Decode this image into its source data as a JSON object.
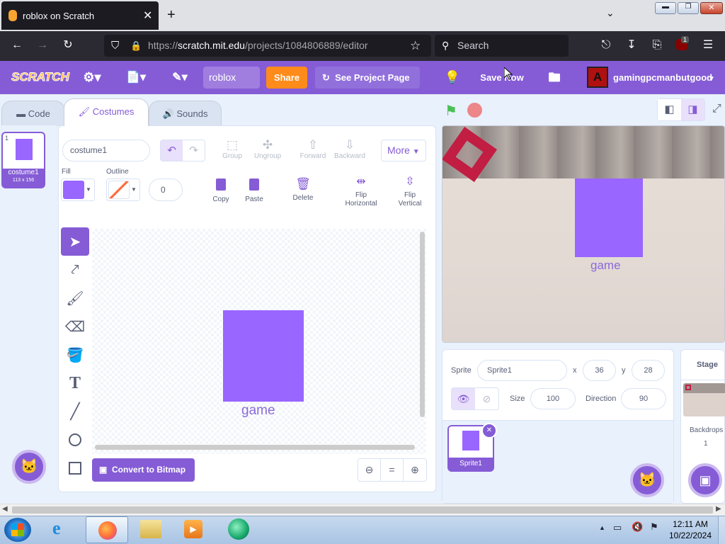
{
  "browser": {
    "tab_title": "roblox on Scratch",
    "url": "https://scratch.mit.edu/projects/1084806889/editor",
    "url_host": "scratch.mit.edu",
    "url_prefix": "https://",
    "url_path": "/projects/1084806889/editor",
    "search_placeholder": "Search",
    "extension_badge": "1"
  },
  "menu": {
    "project_title": "roblox",
    "share_label": "Share",
    "see_project_label": "See Project Page",
    "save_label": "Save Now",
    "username": "gamingpcmanbutgood",
    "brand_color": "#855cd6"
  },
  "tabs": {
    "code": "Code",
    "costumes": "Costumes",
    "sounds": "Sounds"
  },
  "costume_list": [
    {
      "index": "1",
      "name": "costume1",
      "size": "113 x 156"
    }
  ],
  "paint": {
    "costume_name": "costume1",
    "fill_label": "Fill",
    "outline_label": "Outline",
    "outline_width": "0",
    "group_label": "Group",
    "ungroup_label": "Ungroup",
    "forward_label": "Forward",
    "backward_label": "Backward",
    "more_label": "More",
    "copy_label": "Copy",
    "paste_label": "Paste",
    "delete_label": "Delete",
    "flip_h_label": "Flip Horizontal",
    "flip_v_label": "Flip Vertical",
    "convert_label": "Convert to Bitmap",
    "canvas_text": "game",
    "fill_color": "#9966ff"
  },
  "stage": {
    "sprite_text": "game"
  },
  "sprite_info": {
    "sprite_label": "Sprite",
    "sprite_name": "Sprite1",
    "x_label": "x",
    "x_value": "36",
    "y_label": "y",
    "y_value": "28",
    "size_label": "Size",
    "size_value": "100",
    "direction_label": "Direction",
    "direction_value": "90",
    "sprites": [
      {
        "name": "Sprite1"
      }
    ]
  },
  "stage_panel": {
    "title": "Stage",
    "backdrops_label": "Backdrops",
    "backdrops_count": "1"
  },
  "taskbar": {
    "time": "12:11 AM",
    "date": "10/22/2024"
  }
}
